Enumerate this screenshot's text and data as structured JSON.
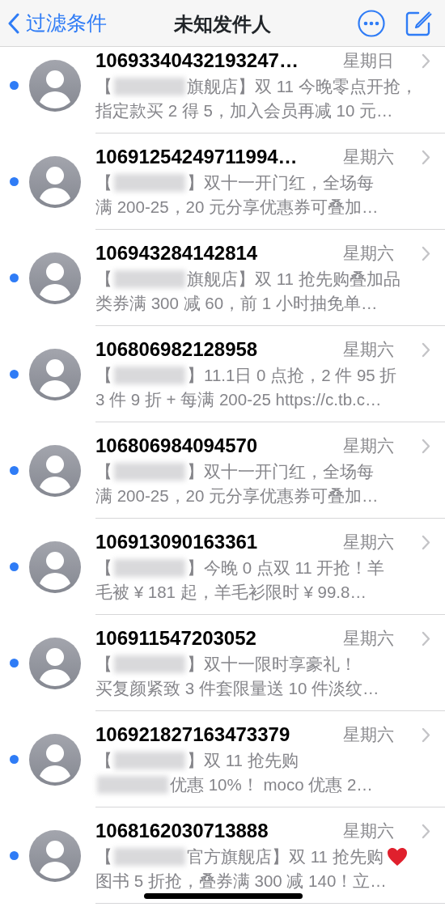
{
  "nav_bar": {
    "back_label": "过滤条件",
    "title": "未知发件人"
  },
  "messages": [
    {
      "sender": "10693340432193247…",
      "time": "星期日",
      "unread": true,
      "preview": [
        [
          {
            "kind": "text",
            "text": "【"
          },
          {
            "kind": "blur"
          },
          {
            "kind": "text",
            "text": "旗舰店】双 11 今晚零点开抢，"
          }
        ],
        [
          {
            "kind": "text",
            "text": "指定款买 2 得 5，加入会员再减 10 元…"
          }
        ]
      ]
    },
    {
      "sender": "10691254249711994…",
      "time": "星期六",
      "unread": true,
      "preview": [
        [
          {
            "kind": "text",
            "text": "【"
          },
          {
            "kind": "blur"
          },
          {
            "kind": "text",
            "text": "】双十一开门红，全场每"
          }
        ],
        [
          {
            "kind": "text",
            "text": "满 200-25，20 元分享优惠券可叠加…"
          }
        ]
      ]
    },
    {
      "sender": "106943284142814",
      "time": "星期六",
      "unread": true,
      "preview": [
        [
          {
            "kind": "text",
            "text": "【"
          },
          {
            "kind": "blur"
          },
          {
            "kind": "text",
            "text": "旗舰店】双 11 抢先购叠加品"
          }
        ],
        [
          {
            "kind": "text",
            "text": "类券满 300 减 60，前 1 小时抽免单…"
          }
        ]
      ]
    },
    {
      "sender": "106806982128958",
      "time": "星期六",
      "unread": true,
      "preview": [
        [
          {
            "kind": "text",
            "text": "【"
          },
          {
            "kind": "blur"
          },
          {
            "kind": "text",
            "text": "】11.1日 0 点抢，2 件 95 折"
          }
        ],
        [
          {
            "kind": "text",
            "text": "3 件 9 折 + 每满 200-25 https://c.tb.c…"
          }
        ]
      ]
    },
    {
      "sender": "106806984094570",
      "time": "星期六",
      "unread": true,
      "preview": [
        [
          {
            "kind": "text",
            "text": "【"
          },
          {
            "kind": "blur"
          },
          {
            "kind": "text",
            "text": "】双十一开门红，全场每"
          }
        ],
        [
          {
            "kind": "text",
            "text": "满 200-25，20 元分享优惠券可叠加…"
          }
        ]
      ]
    },
    {
      "sender": "106913090163361",
      "time": "星期六",
      "unread": true,
      "preview": [
        [
          {
            "kind": "text",
            "text": "【"
          },
          {
            "kind": "blur"
          },
          {
            "kind": "text",
            "text": "】今晚 0 点双 11 开抢！羊"
          }
        ],
        [
          {
            "kind": "text",
            "text": "毛被 ¥ 181 起，羊毛衫限时 ¥ 99.8…"
          }
        ]
      ]
    },
    {
      "sender": "106911547203052",
      "time": "星期六",
      "unread": true,
      "preview": [
        [
          {
            "kind": "text",
            "text": "【"
          },
          {
            "kind": "blur"
          },
          {
            "kind": "text",
            "text": "】双十一限时享豪礼！"
          }
        ],
        [
          {
            "kind": "text",
            "text": "买复颜紧致 3 件套限量送 10 件淡纹…"
          }
        ]
      ]
    },
    {
      "sender": "106921827163473379",
      "time": "星期六",
      "unread": true,
      "preview": [
        [
          {
            "kind": "text",
            "text": "【"
          },
          {
            "kind": "blur"
          },
          {
            "kind": "text",
            "text": "】双 11 抢先购"
          }
        ],
        [
          {
            "kind": "blur"
          },
          {
            "kind": "text",
            "text": "优惠 10%！ moco 优惠 2…"
          }
        ]
      ]
    },
    {
      "sender": "1068162030713888",
      "time": "星期六",
      "unread": true,
      "preview": [
        [
          {
            "kind": "text",
            "text": "【"
          },
          {
            "kind": "blur"
          },
          {
            "kind": "text",
            "text": "官方旗舰店】双 11 抢先购"
          },
          {
            "kind": "heart"
          }
        ],
        [
          {
            "kind": "text",
            "text": "图书 5 折抢，叠券满 300 减 140！立…"
          }
        ]
      ]
    }
  ]
}
